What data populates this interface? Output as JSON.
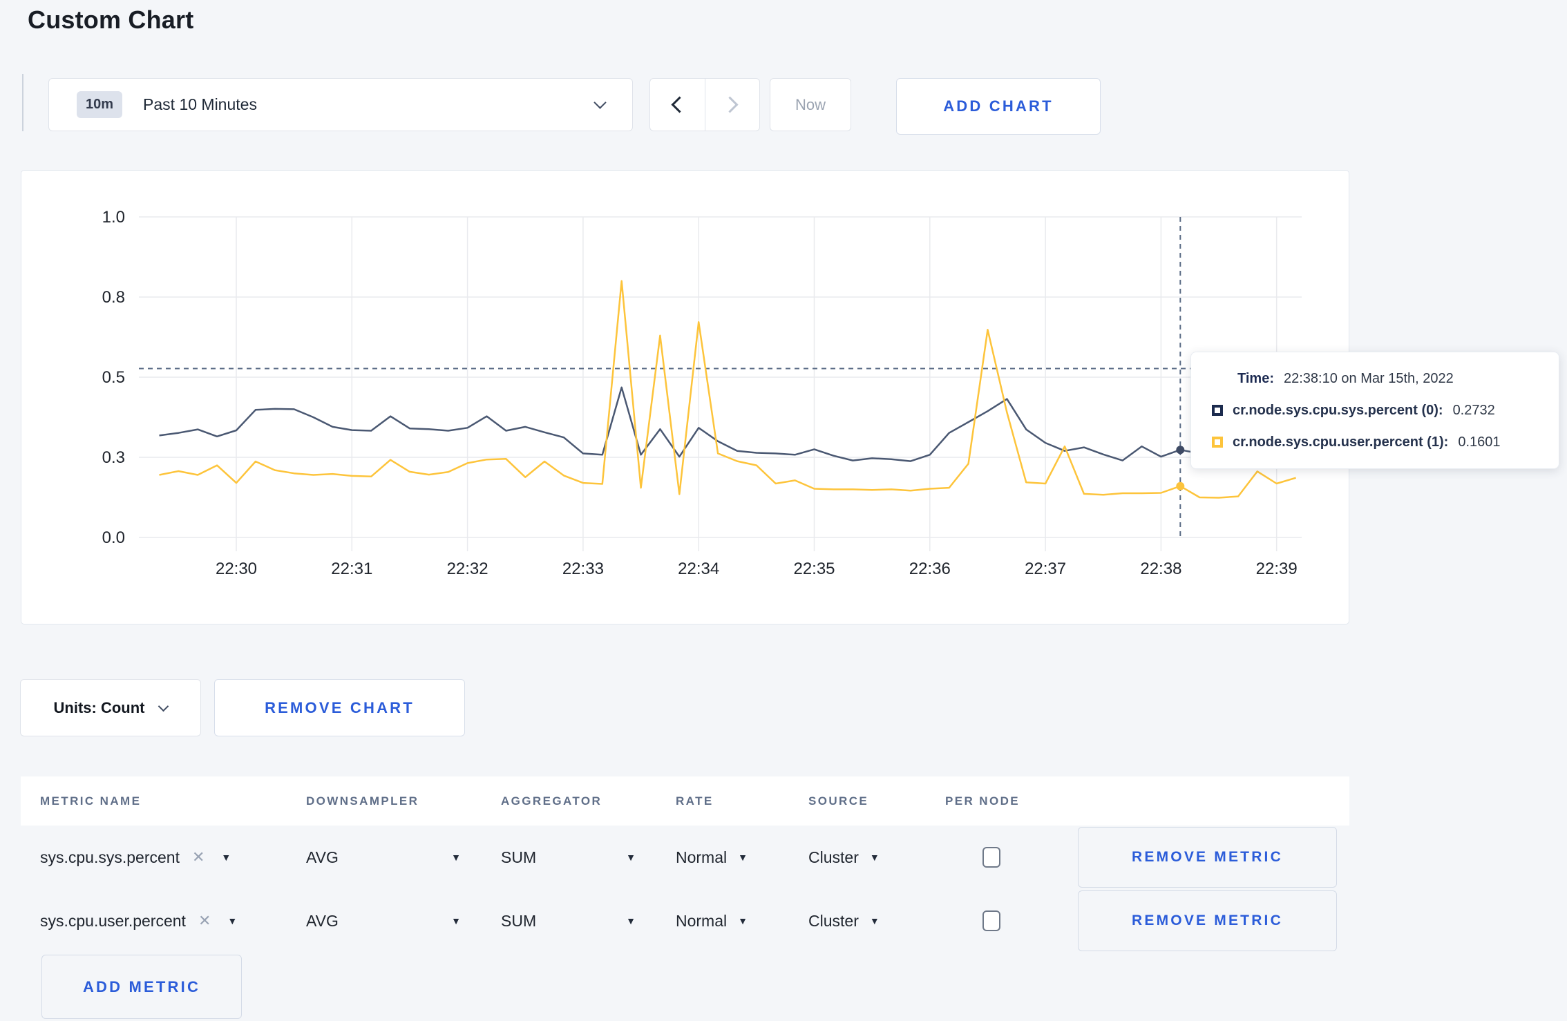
{
  "page": {
    "title": "Custom Chart",
    "background": "#f4f6f9",
    "accent_color": "#2b5cd9"
  },
  "toolbar": {
    "timescale": {
      "badge": "10m",
      "label": "Past 10 Minutes",
      "caret_icon": "chevron-down"
    },
    "nav": {
      "back_icon": "chevron-left",
      "forward_icon": "chevron-right",
      "now_label": "Now"
    },
    "add_chart_label": "ADD CHART"
  },
  "chart_data": {
    "type": "line",
    "title": "",
    "xlabel": "",
    "ylabel": "",
    "ylim": [
      0,
      1
    ],
    "grid": true,
    "legend_position": "none",
    "x_ticks": [
      "22:30",
      "22:31",
      "22:32",
      "22:33",
      "22:34",
      "22:35",
      "22:36",
      "22:37",
      "22:38",
      "22:39"
    ],
    "y_ticks": [
      {
        "label": "0.0",
        "value": 0
      },
      {
        "label": "0.3",
        "value": 0.25
      },
      {
        "label": "0.5",
        "value": 0.5
      },
      {
        "label": "0.8",
        "value": 0.75
      },
      {
        "label": "1.0",
        "value": 1.0
      }
    ],
    "t0_minutes": -0.6667,
    "dt_minutes": 0.16667,
    "crosshair": {
      "index": 53,
      "time": "22:38:10",
      "y_value": 0.527
    },
    "series": [
      {
        "name": "cr.node.sys.cpu.sys.percent",
        "color": "#4a5872",
        "dot_color": "#3e4a64",
        "values": [
          0.318,
          0.326,
          0.337,
          0.315,
          0.334,
          0.398,
          0.401,
          0.4,
          0.375,
          0.345,
          0.335,
          0.333,
          0.378,
          0.34,
          0.338,
          0.333,
          0.342,
          0.378,
          0.333,
          0.345,
          0.328,
          0.312,
          0.262,
          0.258,
          0.468,
          0.258,
          0.338,
          0.252,
          0.342,
          0.3,
          0.27,
          0.264,
          0.262,
          0.258,
          0.275,
          0.255,
          0.24,
          0.247,
          0.244,
          0.238,
          0.258,
          0.326,
          0.36,
          0.394,
          0.432,
          0.337,
          0.295,
          0.27,
          0.281,
          0.259,
          0.24,
          0.284,
          0.252,
          0.2732,
          0.262,
          0.27,
          0.296,
          0.318,
          0.296,
          0.308
        ]
      },
      {
        "name": "cr.node.sys.cpu.user.percent",
        "color": "#fdc43b",
        "dot_color": "#fcc33c",
        "values": [
          0.195,
          0.207,
          0.195,
          0.225,
          0.17,
          0.237,
          0.21,
          0.2,
          0.195,
          0.198,
          0.192,
          0.19,
          0.242,
          0.205,
          0.196,
          0.204,
          0.232,
          0.243,
          0.245,
          0.188,
          0.237,
          0.193,
          0.17,
          0.167,
          0.8,
          0.155,
          0.63,
          0.135,
          0.672,
          0.262,
          0.238,
          0.225,
          0.168,
          0.178,
          0.152,
          0.15,
          0.15,
          0.148,
          0.15,
          0.146,
          0.152,
          0.155,
          0.23,
          0.648,
          0.39,
          0.172,
          0.168,
          0.284,
          0.136,
          0.133,
          0.138,
          0.138,
          0.139,
          0.1601,
          0.125,
          0.124,
          0.128,
          0.206,
          0.168,
          0.186
        ]
      }
    ]
  },
  "tooltip": {
    "time_label": "Time:",
    "time_value": "22:38:10 on Mar 15th, 2022",
    "rows": [
      {
        "label": "cr.node.sys.cpu.sys.percent (0):",
        "value": "0.2732",
        "color": "#1c2b4e"
      },
      {
        "label": "cr.node.sys.cpu.user.percent (1):",
        "value": "0.1601",
        "color": "#fdc43b"
      }
    ]
  },
  "chart_controls": {
    "units_label": "Units: Count",
    "remove_chart_label": "REMOVE CHART"
  },
  "metrics_table": {
    "headers": [
      "METRIC NAME",
      "DOWNSAMPLER",
      "AGGREGATOR",
      "RATE",
      "SOURCE",
      "PER NODE"
    ],
    "rows": [
      {
        "name": "sys.cpu.sys.percent",
        "downsampler": "AVG",
        "aggregator": "SUM",
        "rate": "Normal",
        "source": "Cluster",
        "per_node_checked": false
      },
      {
        "name": "sys.cpu.user.percent",
        "downsampler": "AVG",
        "aggregator": "SUM",
        "rate": "Normal",
        "source": "Cluster",
        "per_node_checked": false
      }
    ],
    "clear_icon": "x",
    "caret_icon": "triangle-down",
    "remove_metric_label": "REMOVE METRIC",
    "add_metric_label": "ADD METRIC"
  }
}
